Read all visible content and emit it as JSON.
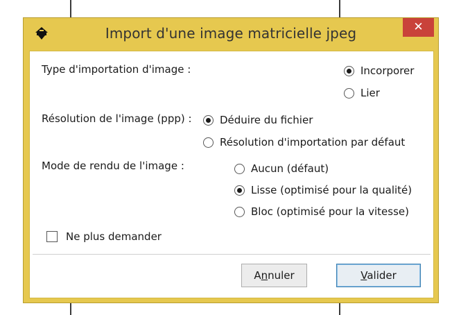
{
  "window": {
    "title": "Import d'une image matricielle jpeg",
    "app_icon": "inkscape-icon",
    "close_glyph": "✕"
  },
  "image_type": {
    "label": "Type d'importation d'image :",
    "options": [
      {
        "label": "Incorporer",
        "selected": true
      },
      {
        "label": "Lier",
        "selected": false
      }
    ]
  },
  "resolution": {
    "label": "Résolution de l'image (ppp) :",
    "options": [
      {
        "label": "Déduire du fichier",
        "selected": true
      },
      {
        "label": "Résolution d'importation par défaut",
        "selected": false
      }
    ]
  },
  "render_mode": {
    "label": "Mode de rendu de l'image :",
    "options": [
      {
        "label": "Aucun (défaut)",
        "selected": false
      },
      {
        "label": "Lisse (optimisé pour la qualité)",
        "selected": true
      },
      {
        "label": "Bloc (optimisé pour la vitesse)",
        "selected": false
      }
    ]
  },
  "dont_ask": {
    "label": "Ne plus demander",
    "checked": false
  },
  "buttons": {
    "cancel": {
      "before": "A",
      "mnemonic": "n",
      "after": "nuler"
    },
    "ok": {
      "before": "",
      "mnemonic": "V",
      "after": "alider"
    }
  }
}
